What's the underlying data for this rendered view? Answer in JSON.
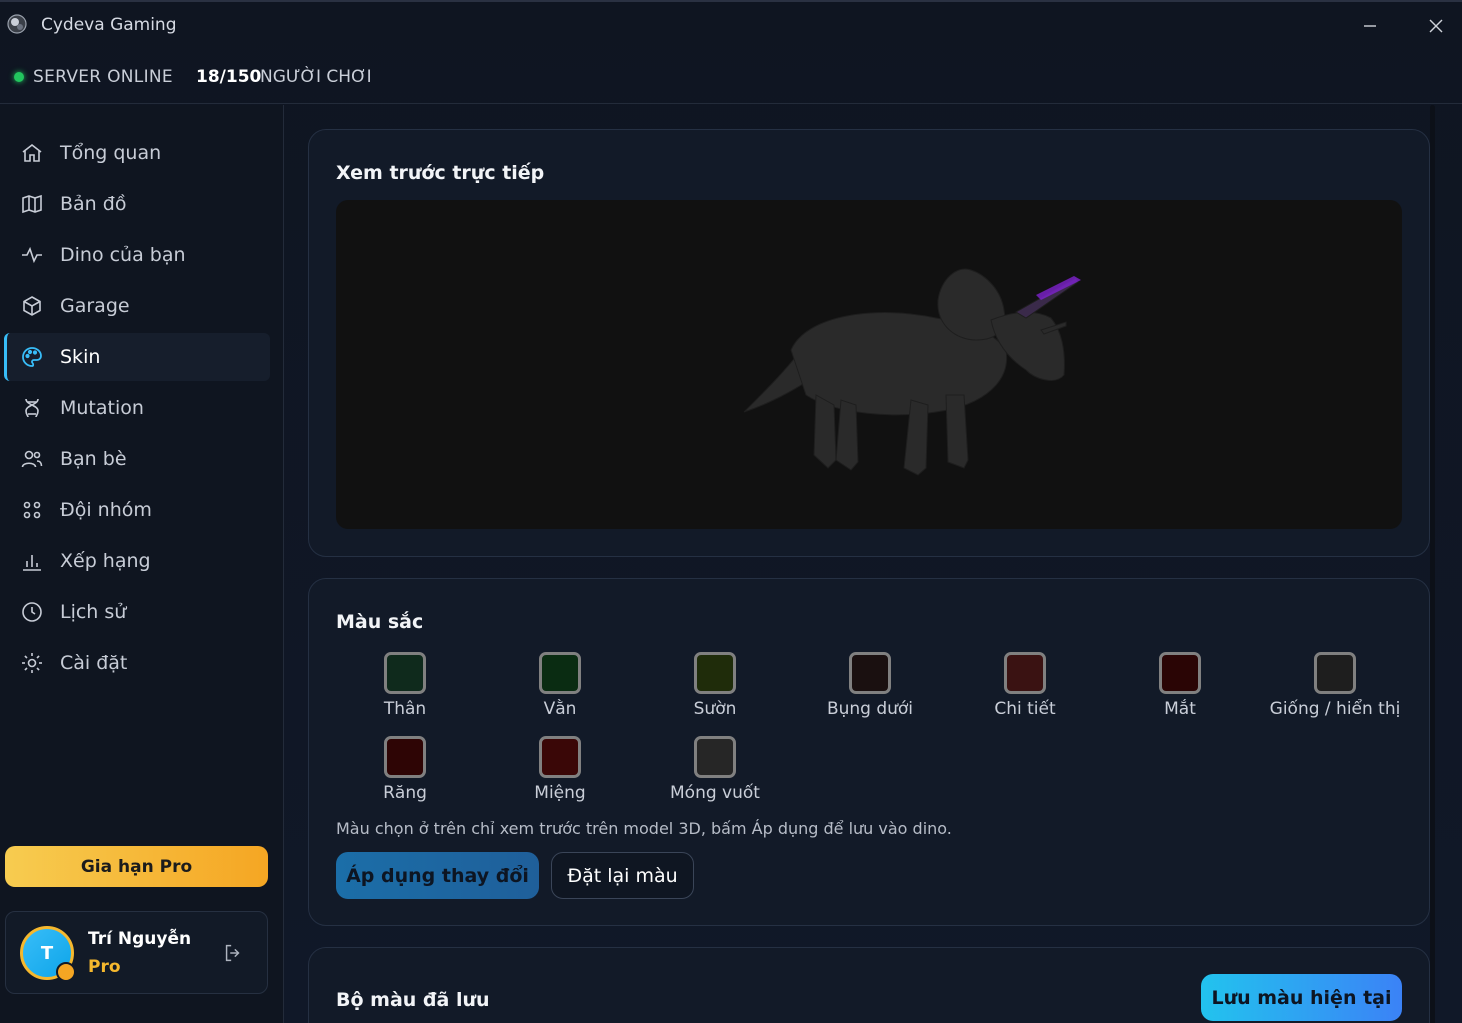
{
  "app": {
    "title": "Cydeva Gaming",
    "minimize": "—",
    "close": "✕"
  },
  "status": {
    "server": "SERVER ONLINE",
    "players": "18/150",
    "players_label": "NGƯỜI CHƠI",
    "dot_color": "#22c55e"
  },
  "sidebar": {
    "items": [
      {
        "label": "Tổng quan",
        "icon": "home-icon"
      },
      {
        "label": "Bản đồ",
        "icon": "map-icon"
      },
      {
        "label": "Dino của bạn",
        "icon": "activity-icon"
      },
      {
        "label": "Garage",
        "icon": "cube-icon"
      },
      {
        "label": "Skin",
        "icon": "palette-icon",
        "active": true
      },
      {
        "label": "Mutation",
        "icon": "dna-icon"
      },
      {
        "label": "Bạn bè",
        "icon": "friends-icon"
      },
      {
        "label": "Đội nhóm",
        "icon": "team-icon"
      },
      {
        "label": "Xếp hạng",
        "icon": "chart-icon"
      },
      {
        "label": "Lịch sử",
        "icon": "clock-icon"
      },
      {
        "label": "Cài đặt",
        "icon": "settings-icon"
      }
    ],
    "pro_button": "Gia hạn Pro",
    "user": {
      "initial": "T",
      "name": "Trí Nguyễn",
      "tier": "Pro"
    }
  },
  "preview": {
    "title": "Xem trước trực tiếp"
  },
  "colors": {
    "title": "Màu sắc",
    "swatches": [
      {
        "label": "Thân",
        "color": "#0f2a1c"
      },
      {
        "label": "Vằn",
        "color": "#0a2c12"
      },
      {
        "label": "Sườn",
        "color": "#1f2c0a"
      },
      {
        "label": "Bụng dưới",
        "color": "#1a1010"
      },
      {
        "label": "Chi tiết",
        "color": "#3a1212"
      },
      {
        "label": "Mắt",
        "color": "#2a0505"
      },
      {
        "label": "Giống / hiển thị",
        "color": "#1e1e1e"
      },
      {
        "label": "Răng",
        "color": "#2e0505"
      },
      {
        "label": "Miệng",
        "color": "#3a0707"
      },
      {
        "label": "Móng vuốt",
        "color": "#262626"
      }
    ],
    "hint": "Màu chọn ở trên chỉ xem trước trên model 3D, bấm Áp dụng để lưu vào dino.",
    "apply_button": "Áp dụng thay đổi",
    "reset_button": "Đặt lại màu"
  },
  "saved": {
    "title": "Bộ màu đã lưu",
    "save_button": "Lưu màu hiện tại"
  }
}
